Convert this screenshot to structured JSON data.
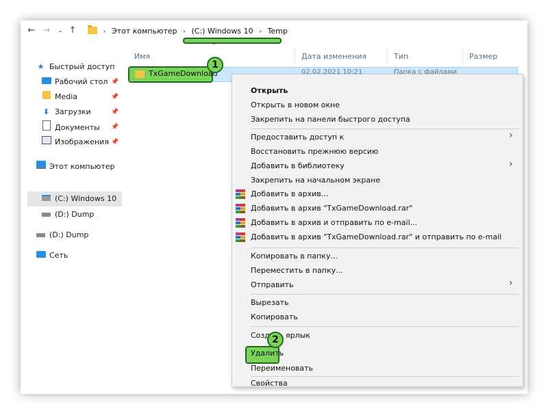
{
  "address": {
    "segments": [
      "Этот компьютер",
      "(C:) Windows 10",
      "Temp"
    ]
  },
  "columns": {
    "name": "Имя",
    "date": "Дата изменения",
    "type": "Тип",
    "size": "Размер"
  },
  "file": {
    "name": "TxGameDownload",
    "date": "02.02.2021 10:21",
    "type": "Папка с файлами"
  },
  "badges": {
    "one": "1",
    "two": "2"
  },
  "sidebar": {
    "quick_access": "Быстрый доступ",
    "desktop": "Рабочий стол",
    "media": "Media",
    "downloads": "Загрузки",
    "documents": "Документы",
    "images": "Изображения",
    "this_pc": "Этот компьютер",
    "drive_c": "(C:) Windows 10",
    "drive_d": "(D:) Dump",
    "drive_d2": "(D:) Dump",
    "network": "Сеть"
  },
  "menu": {
    "open": "Открыть",
    "open_new_window": "Открыть в новом окне",
    "pin_quick": "Закрепить на панели быстрого доступа",
    "share": "Предоставить доступ к",
    "restore": "Восстановить прежнюю версию",
    "add_library": "Добавить в библиотеку",
    "pin_start": "Закрепить на начальном экране",
    "add_archive": "Добавить в архив...",
    "add_archive_rar": "Добавить в архив \"TxGameDownload.rar\"",
    "add_archive_email": "Добавить в архив и отправить по e-mail...",
    "add_archive_rar_email": "Добавить в архив \"TxGameDownload.rar\" и отправить по e-mail",
    "copy_to": "Копировать в папку...",
    "move_to": "Переместить в папку...",
    "send_to": "Отправить",
    "cut": "Вырезать",
    "copy": "Копировать",
    "create_shortcut": "Создать ярлык",
    "delete": "Удалить",
    "rename": "Переименовать",
    "properties": "Свойства"
  },
  "colors": {
    "highlight_green": "#7bd35a",
    "highlight_border": "#1e6b1e",
    "selection_blue": "#cce8ff"
  }
}
